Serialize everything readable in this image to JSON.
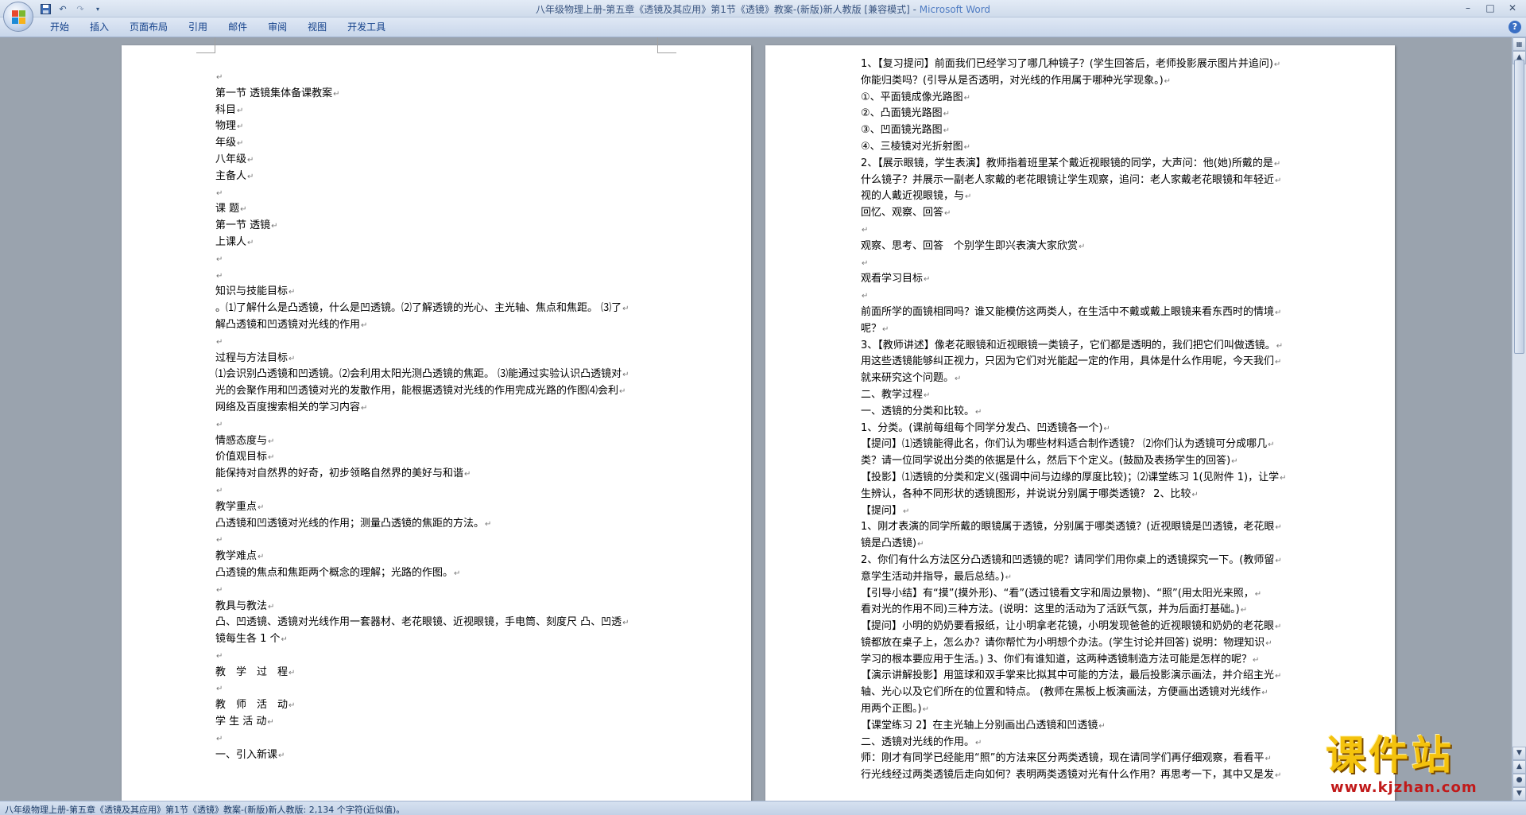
{
  "window": {
    "title": "八年级物理上册-第五章《透镜及其应用》第1节《透镜》教案-(新版)新人教版 [兼容模式] - ",
    "app_name": "Microsoft Word",
    "controls": [
      "minimize",
      "maximize",
      "close"
    ]
  },
  "quick_access": [
    {
      "icon": "save-icon"
    },
    {
      "icon": "undo-icon"
    },
    {
      "icon": "redo-icon"
    },
    {
      "icon": "customize-dropdown-icon"
    }
  ],
  "ribbon": {
    "tabs": [
      "开始",
      "插入",
      "页面布局",
      "引用",
      "邮件",
      "审阅",
      "视图",
      "开发工具"
    ],
    "help": "?"
  },
  "pages": {
    "left": [
      "",
      "第一节 透镜集体备课教案",
      "科目",
      "物理",
      "年级",
      "八年级",
      "主备人",
      "",
      "课 题",
      "第一节 透镜",
      "上课人",
      "",
      "",
      "知识与技能目标",
      "。⑴了解什么是凸透镜，什么是凹透镜。⑵了解透镜的光心、主光轴、焦点和焦距。 ⑶了",
      "解凸透镜和凹透镜对光线的作用",
      "",
      "过程与方法目标",
      "⑴会识别凸透镜和凹透镜。⑵会利用太阳光测凸透镜的焦距。 ⑶能通过实验认识凸透镜对",
      "光的会聚作用和凹透镜对光的发散作用，能根据透镜对光线的作用完成光路的作图⑷会利",
      "网络及百度搜索相关的学习内容",
      "",
      "情感态度与",
      "价值观目标",
      "能保持对自然界的好奇，初步领略自然界的美好与和谐",
      "",
      "教学重点",
      "凸透镜和凹透镜对光线的作用；测量凸透镜的焦距的方法。",
      "",
      "教学难点",
      "凸透镜的焦点和焦距两个概念的理解；光路的作图。",
      "",
      "教具与教法",
      "凸、凹透镜、透镜对光线作用一套器材、老花眼镜、近视眼镜，手电筒、刻度尺 凸、凹透",
      "镜每生各 1 个",
      "",
      "教　学　过　程",
      "",
      "教　师　活　动",
      "学 生 活 动",
      "",
      "一、引入新课"
    ],
    "right": [
      "1、【复习提问】前面我们已经学习了哪几种镜子？(学生回答后，老师投影展示图片并追问)",
      "你能归类吗？(引导从是否透明，对光线的作用属于哪种光学现象。)",
      "①、平面镜成像光路图",
      "②、凸面镜光路图",
      "③、凹面镜光路图",
      "④、三棱镜对光折射图",
      "2、【展示眼镜，学生表演】教师指着班里某个戴近视眼镜的同学，大声问：他(她)所戴的是",
      "什么镜子？并展示一副老人家戴的老花眼镜让学生观察，追问：老人家戴老花眼镜和年轻近",
      "视的人戴近视眼镜，与",
      "回忆、观察、回答",
      "",
      "观察、思考、回答　个别学生即兴表演大家欣赏",
      "",
      "观看学习目标",
      "",
      "前面所学的面镜相同吗？谁又能模仿这两类人，在生活中不戴或戴上眼镜来看东西时的情境",
      "呢？",
      "3、【教师讲述】像老花眼镜和近视眼镜一类镜子，它们都是透明的，我们把它们叫做透镜。",
      "用这些透镜能够纠正视力，只因为它们对光能起一定的作用，具体是什么作用呢，今天我们",
      "就来研究这个问题。",
      "二、教学过程",
      "一、透镜的分类和比较。",
      "1、分类。(课前每组每个同学分发凸、凹透镜各一个)",
      "【提问】⑴透镜能得此名，你们认为哪些材料适合制作透镜？ ⑵你们认为透镜可分成哪几",
      "类？请一位同学说出分类的依据是什么，然后下个定义。(鼓励及表扬学生的回答)",
      "【投影】⑴透镜的分类和定义(强调中间与边缘的厚度比较)；⑵课堂练习 1(见附件 1)，让学",
      "生辨认，各种不同形状的透镜图形，并说说分别属于哪类透镜？ 2、比较",
      "【提问】",
      "1、刚才表演的同学所戴的眼镜属于透镜，分别属于哪类透镜？(近视眼镜是凹透镜，老花眼",
      "镜是凸透镜)",
      "2、你们有什么方法区分凸透镜和凹透镜的呢？请同学们用你桌上的透镜探究一下。(教师留",
      "意学生活动并指导，最后总结。)",
      "【引导小结】有“摸”(摸外形)、“看”(透过镜看文字和周边景物)、“照”(用太阳光来照，",
      "看对光的作用不同)三种方法。(说明：这里的活动为了活跃气氛，并为后面打基础。)",
      "【提问】小明的奶奶要看报纸，让小明拿老花镜，小明发现爸爸的近视眼镜和奶奶的老花眼",
      "镜都放在桌子上，怎么办？请你帮忙为小明想个办法。(学生讨论并回答) 说明：物理知识",
      "学习的根本要应用于生活。) 3、你们有谁知道，这两种透镜制造方法可能是怎样的呢？",
      "【演示讲解投影】用篮球和双手掌来比拟其中可能的方法，最后投影演示画法，并介绍主光",
      "轴、光心以及它们所在的位置和特点。 (教师在黑板上板演画法，方便画出透镜对光线作",
      "用两个正图。)",
      "【课堂练习 2】在主光轴上分别画出凸透镜和凹透镜",
      " 二、透镜对光线的作用。",
      "师：刚才有同学已经能用“照”的方法来区分两类透镜，现在请同学们再仔细观察，看看平",
      "行光线经过两类透镜后走向如何？表明两类透镜对光有什么作用？再思考一下，其中又是发"
    ]
  },
  "status_bar": {
    "text": "八年级物理上册-第五章《透镜及其应用》第1节《透镜》教案-(新版)新人教版: 2,134 个字符(近似值)。"
  },
  "watermark": {
    "main": "课件站",
    "sub": "www.kjzhan.com"
  },
  "colors": {
    "ribbon_text": "#15428b",
    "workspace": "#9aa3ae",
    "watermark_yellow": "#f4c20d",
    "watermark_red": "#c11a1a"
  }
}
